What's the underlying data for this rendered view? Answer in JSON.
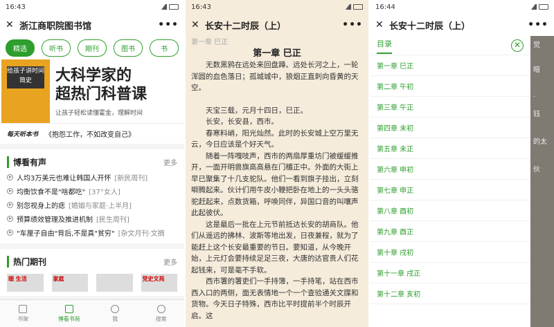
{
  "p1": {
    "time": "16:43",
    "title": "浙江商职院图书馆",
    "tabs": [
      "精选",
      "听书",
      "期刊",
      "图书",
      "书"
    ],
    "banner": {
      "cover": "给孩子讲时间简史",
      "big1": "大科学家的",
      "big2": "超热门科普课",
      "sub": "让孩子轻松读懂霍金，理解时间"
    },
    "quote": {
      "brand": "每天听本书",
      "text": "《抱怨工作，不如改变自己》"
    },
    "s1": {
      "title": "博看有声",
      "more": "更多",
      "items": [
        {
          "t": "人均3万美元也难让韩国人开怀",
          "s": "[新民周刊]"
        },
        {
          "t": "均衡饮食不是\"啥都吃\"",
          "s": "[37°女人]"
        },
        {
          "t": "别忽视身上的痣",
          "s": "[婚姻与家庭·上半月]"
        },
        {
          "t": "预算绩效管理及推进机制",
          "s": "[民生周刊]"
        },
        {
          "t": "\"车厘子自由\"背后,不是真\"贫穷\"",
          "s": "[杂文月刊·文摘"
        }
      ]
    },
    "s2": {
      "title": "热门期刊",
      "more": "更多",
      "covers": [
        "頤 生活",
        "家庭",
        "",
        "党史文苑"
      ]
    },
    "nav": [
      "书架",
      "博看书苑",
      "我",
      "搜索"
    ]
  },
  "p2": {
    "time": "16:43",
    "title": "长安十二时辰（上）",
    "chtop": "第一章 巳正",
    "chtitle": "第一章 巳正",
    "paras": [
      "无数黑鸦在远处来回盘蹲。远处长河之上，一轮浑圆的血色落日；孤城城中，狼烟正直刺向昏黄的天空。",
      "天宝三载，元月十四日，巳正。",
      "长安，长安县，西市。",
      "春寒料峭，阳光灿然。此时的长安城上空万里无云，今日应该是个好天气。",
      "随着一阵嘎吱声，西市的两扇厚重坊门被缓缓推开，一面开明兽旗高高悬在门楣正中。外面的大街上早已聚集了十几支驼队。他们一看到旗子挂出，立刻噼腾起来。伙计们用牛皮小鞭把卧在地上的一头头骆驼赶起来，点数货箱，呼唤同伴，异国口音的叫嚷声此起彼伏。",
      "这是最后一批在上元节前抵达长安的胡商队。他们从遥远的拂林、波斯等地出发，日夜兼程，就为了能赶上这个长安最重要的节日。要知道，从今晚开始，上元灯会要持续足足三夜，大唐的达官贵人们花起钱来，可是毫不手软。",
      "西市署的署吏们一手持簿，一手持笔，站在西市西入口的两侧，面无表情地一个一个查验通关文牒和货物。今天日子特殊，西市比平时提前半个时辰开启。这"
    ]
  },
  "p3": {
    "time": "16:44",
    "title": "长安十二时辰（上）",
    "toc_label": "目录",
    "chapters": [
      "第一章 巳正",
      "第二章 午初",
      "第三章 午正",
      "第四章 未初",
      "第五章 未正",
      "第六章 申初",
      "第七章 申正",
      "第八章 酉初",
      "第九章 酉正",
      "第十章 戌初",
      "第十一章 戌正",
      "第十二章 亥初"
    ],
    "bg": [
      "觉",
      "",
      "",
      "暗",
      "",
      "",
      ".",
      "钰",
      "",
      "",
      "",
      "的太",
      "",
      "",
      "",
      "伙",
      "",
      "",
      ""
    ]
  },
  "colors": {
    "accent": "#2e9e2e",
    "reader_bg": "#f5ecdb"
  }
}
